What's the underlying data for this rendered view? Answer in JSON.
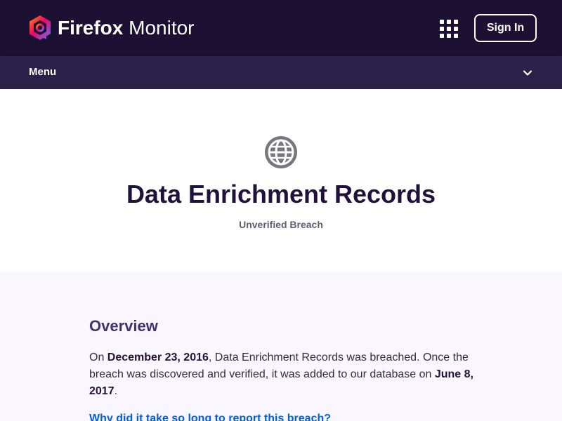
{
  "header": {
    "brand_bold": "Firefox",
    "brand_light": "Monitor",
    "apps_icon": "grid-icon",
    "signin_label": "Sign In"
  },
  "menu": {
    "label": "Menu",
    "icon": "chevron-down-icon"
  },
  "breach": {
    "icon": "globe-icon",
    "title": "Data Enrichment Records",
    "status": "Unverified Breach"
  },
  "overview": {
    "title": "Overview",
    "text_1": "On ",
    "breach_date": "December 23, 2016",
    "text_2": ", Data Enrichment Records was breached. Once the breach was discovered and verified, it was added to our database on ",
    "added_date": "June 8, 2017",
    "text_3": ".",
    "link": "Why did it take so long to report this breach?"
  },
  "colors": {
    "header_bg": "#1d1133",
    "menu_bg": "#2b2047",
    "overview_bg": "#f9f7fd",
    "link": "#0060df"
  }
}
